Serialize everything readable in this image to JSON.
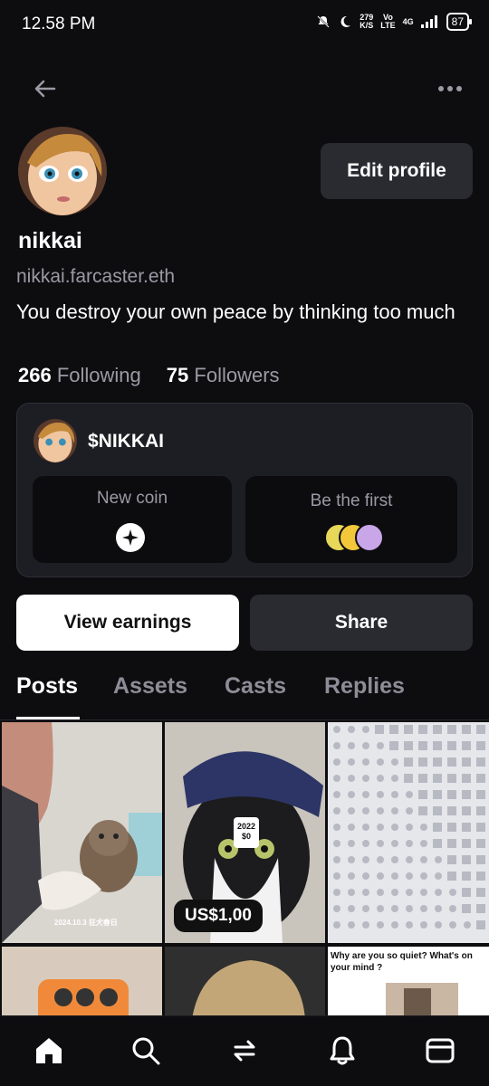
{
  "status_bar": {
    "time": "12.58 PM",
    "net_speed_value": "279",
    "net_speed_unit": "K/S",
    "volte_top": "Vo",
    "volte_bottom": "LTE",
    "network": "4G",
    "battery": "87"
  },
  "nav": {
    "back_icon": "arrow-left-icon",
    "more_icon": "more-horizontal-icon"
  },
  "profile": {
    "edit_label": "Edit profile",
    "username": "nikkai",
    "handle": "nikkai.farcaster.eth",
    "bio": "You destroy your own peace by thinking too much",
    "following_count": "266",
    "following_label": "Following",
    "followers_count": "75",
    "followers_label": "Followers"
  },
  "coin": {
    "name": "$NIKKAI",
    "new_coin_label": "New coin",
    "be_first_label": "Be the first"
  },
  "actions": {
    "view_earnings": "View earnings",
    "share": "Share"
  },
  "tabs": [
    {
      "label": "Posts",
      "active": true
    },
    {
      "label": "Assets",
      "active": false
    },
    {
      "label": "Casts",
      "active": false
    },
    {
      "label": "Replies",
      "active": false
    }
  ],
  "grid": {
    "tile1_date": "2024.10.3 狂犬春日",
    "tile2_price": "US$1,00",
    "tile2_tag_line1": "2022",
    "tile2_tag_line2": "$0",
    "tile6_caption": "Why are you so quiet? What's on your mind ?"
  },
  "bottom_nav": [
    "home-icon",
    "search-icon",
    "recast-icon",
    "bell-icon",
    "wallet-icon"
  ],
  "colors": {
    "background": "#0d0d10",
    "card": "#1d1e23",
    "button_dark": "#2a2b31",
    "muted_text": "#9b9aa4"
  }
}
